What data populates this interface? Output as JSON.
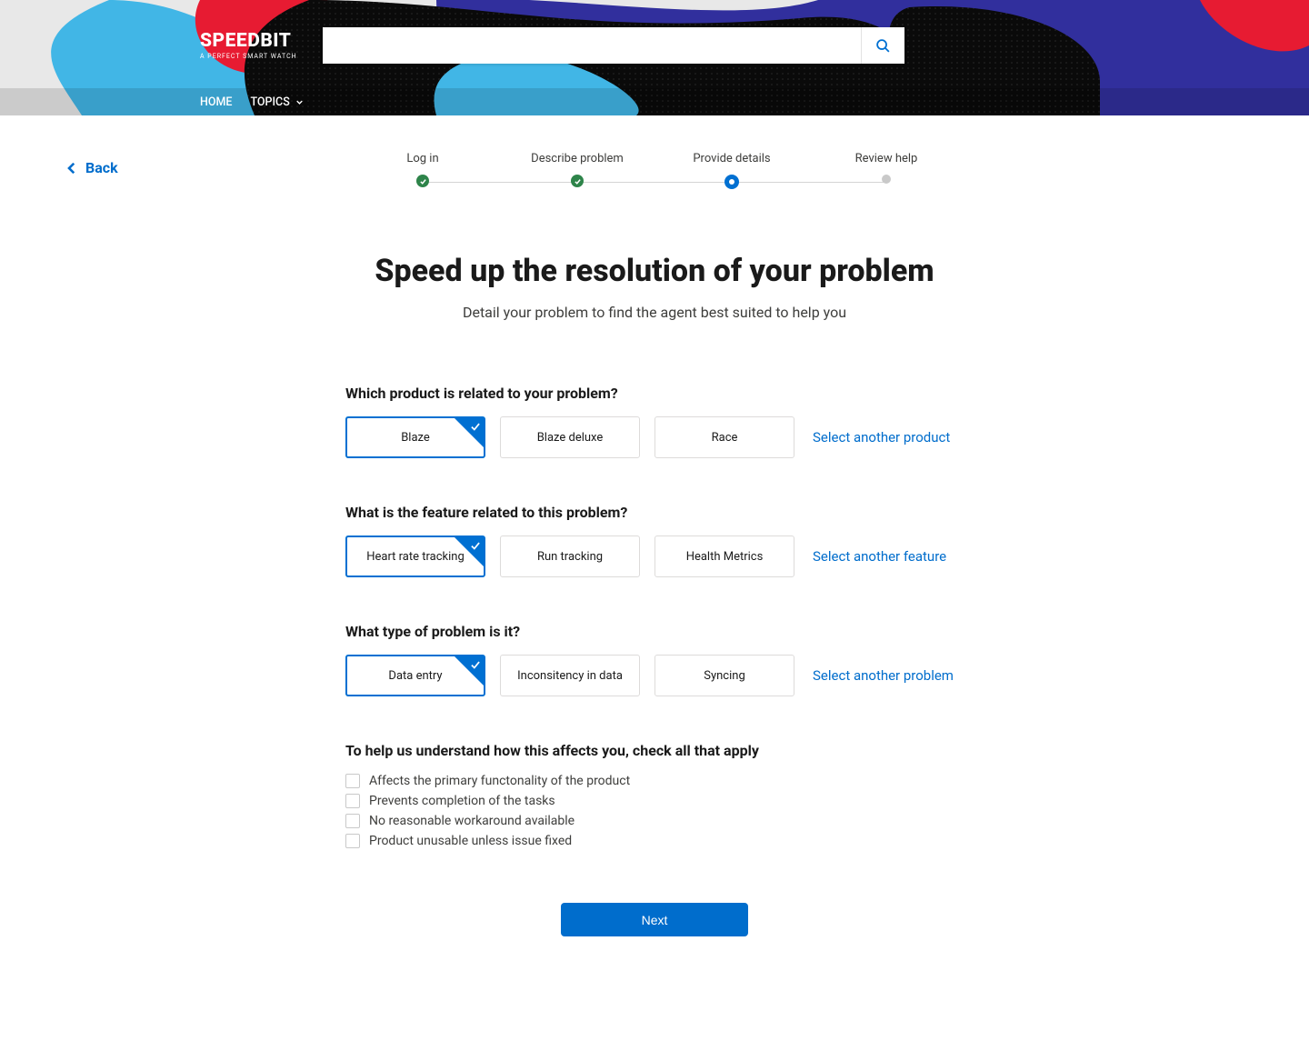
{
  "colors": {
    "primary": "#006dcc",
    "success": "#2e844a"
  },
  "header": {
    "logo_brand": "SPEEDBIT",
    "logo_tagline": "A PERFECT SMART WATCH",
    "search_placeholder": "",
    "nav": {
      "home": "HOME",
      "topics": "TOPICS"
    }
  },
  "back_label": "Back",
  "stepper": {
    "steps": [
      {
        "label": "Log in",
        "state": "done"
      },
      {
        "label": "Describe problem",
        "state": "done"
      },
      {
        "label": "Provide details",
        "state": "current"
      },
      {
        "label": "Review help",
        "state": "future"
      }
    ]
  },
  "heading": "Speed up the resolution of your problem",
  "subheading": "Detail your problem to find the agent best suited to help you",
  "groups": {
    "product": {
      "label": "Which product is related to your problem?",
      "options": [
        "Blaze",
        "Blaze deluxe",
        "Race"
      ],
      "selected": 0,
      "more": "Select another product"
    },
    "feature": {
      "label": "What is the feature related to this problem?",
      "options": [
        "Heart rate tracking",
        "Run tracking",
        "Health Metrics"
      ],
      "selected": 0,
      "more": "Select another feature"
    },
    "problem": {
      "label": "What type of problem is it?",
      "options": [
        "Data entry",
        "Inconsitency in data",
        "Syncing"
      ],
      "selected": 0,
      "more": "Select another problem"
    },
    "impact": {
      "label": "To help us understand how this affects you, check all that apply",
      "items": [
        "Affects the primary functonality of the product",
        "Prevents completion of the tasks",
        "No reasonable workaround available",
        "Product unusable unless issue fixed"
      ]
    }
  },
  "next_label": "Next"
}
